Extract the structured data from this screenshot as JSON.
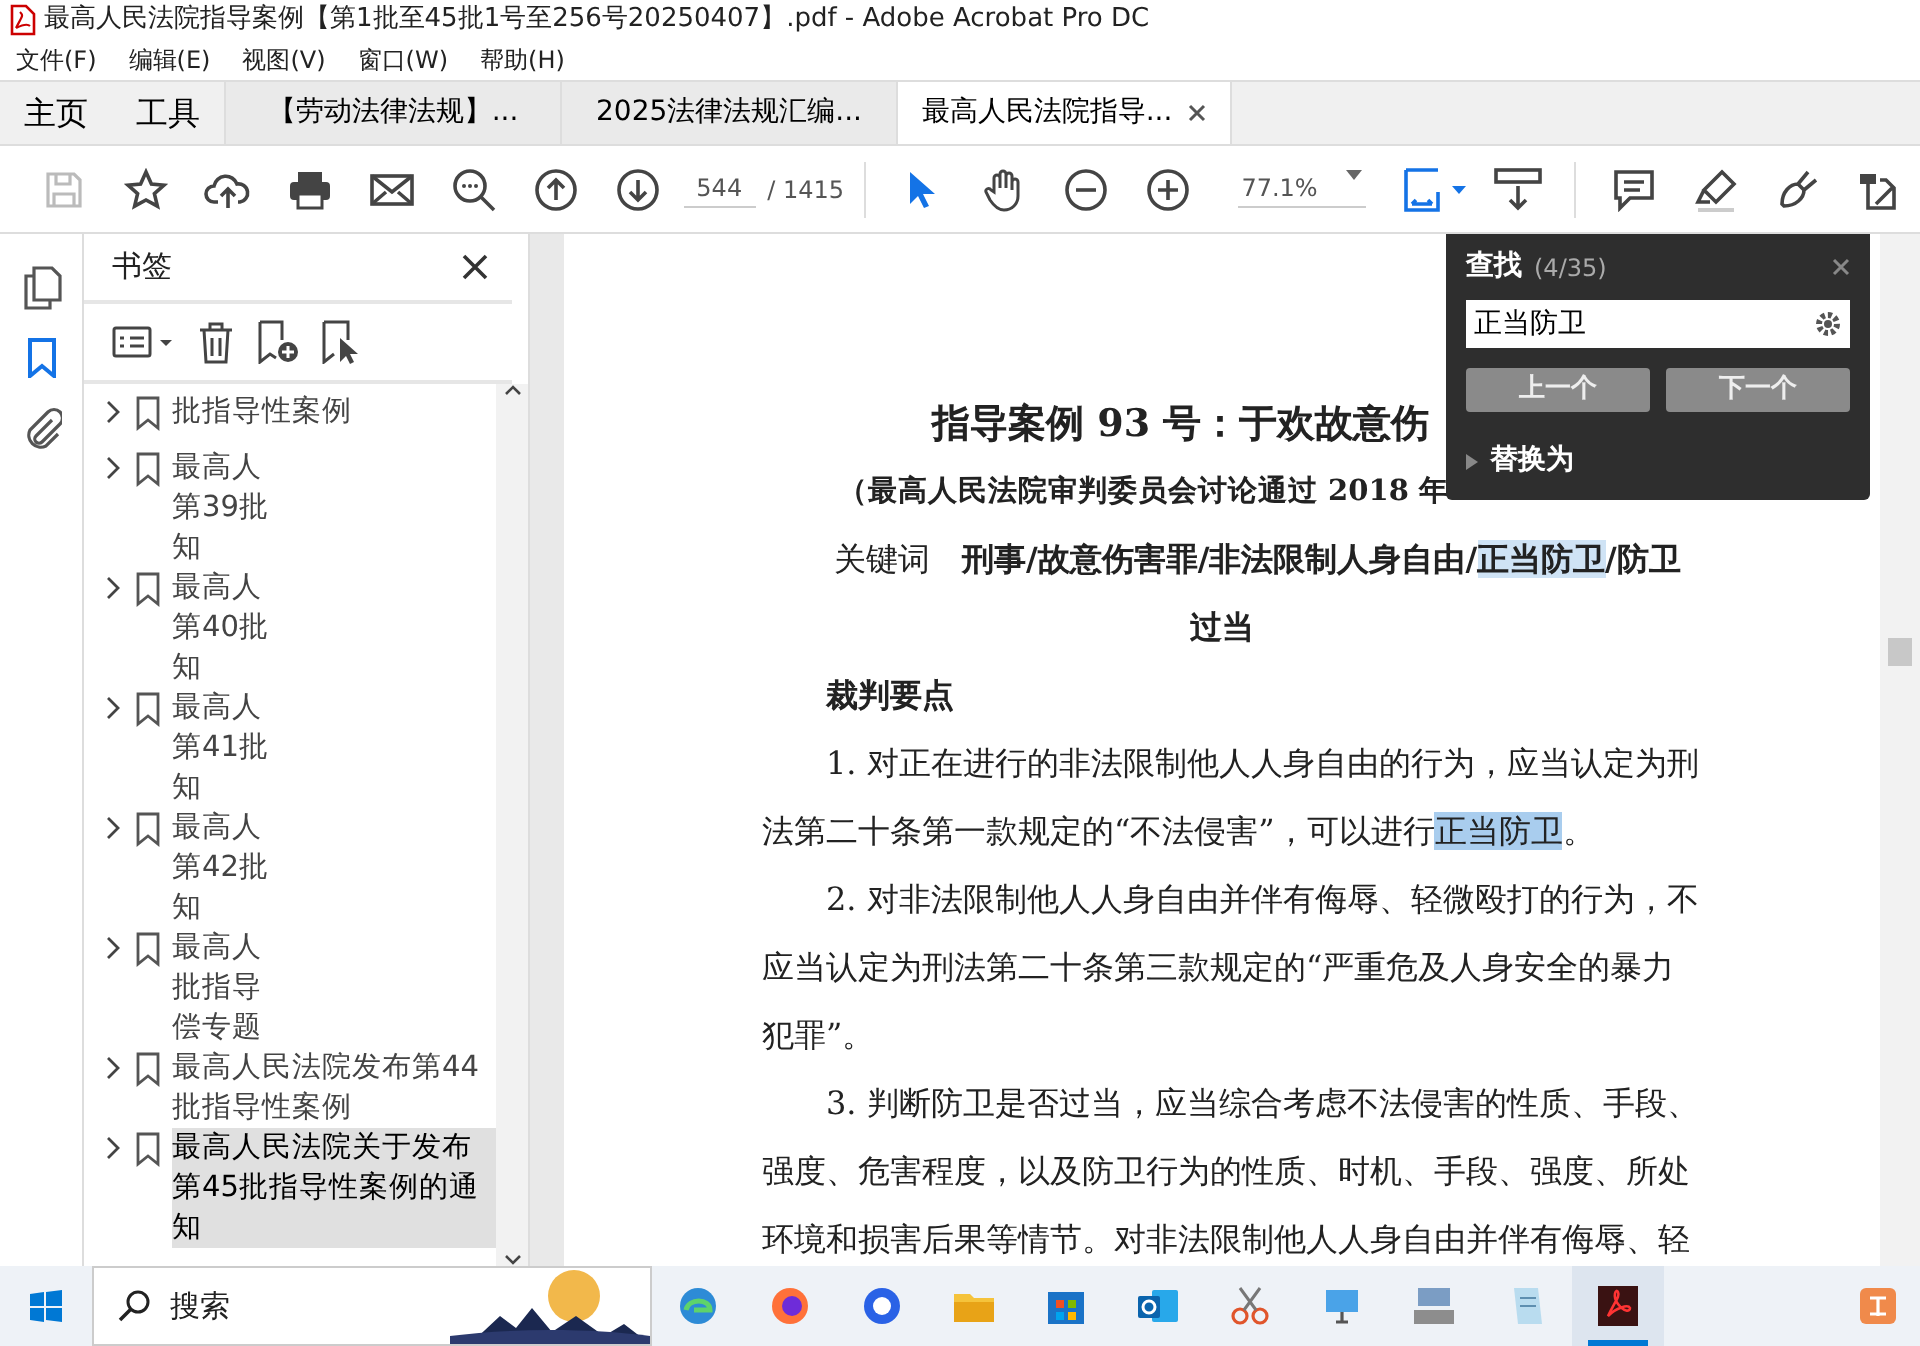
{
  "window": {
    "title": "最高人民法院指导案例【第1批至45批1号至256号20250407】.pdf - Adobe Acrobat Pro DC"
  },
  "menu": [
    "文件(F)",
    "编辑(E)",
    "视图(V)",
    "窗口(W)",
    "帮助(H)"
  ],
  "tabs": [
    {
      "label": "主页",
      "kind": "home",
      "selected": false
    },
    {
      "label": "工具",
      "kind": "home",
      "selected": false
    },
    {
      "label": "【劳动法律法规】...",
      "kind": "document",
      "selected": false
    },
    {
      "label": "2025法律法规汇编...",
      "kind": "document",
      "selected": false
    },
    {
      "label": "最高人民法院指导...",
      "kind": "document",
      "selected": true
    }
  ],
  "toolbar": {
    "page_current": "544",
    "page_total": "/ 1415",
    "zoom": "77.1%",
    "tools": [
      {
        "kind": "select",
        "selected": true
      },
      {
        "kind": "hand",
        "selected": false
      }
    ]
  },
  "side_rail": [
    {
      "kind": "pages",
      "selected": false
    },
    {
      "kind": "bookmarks",
      "selected": true
    },
    {
      "kind": "attachments",
      "selected": false
    }
  ],
  "bookmarks": {
    "title": "书签",
    "items": [
      {
        "lines": [
          "批指导性案例"
        ],
        "selected": false
      },
      {
        "lines": [
          "最高人",
          "第39批",
          "知"
        ],
        "selected": false
      },
      {
        "lines": [
          "最高人",
          "第40批",
          "知"
        ],
        "selected": false
      },
      {
        "lines": [
          "最高人",
          "第41批",
          "知"
        ],
        "selected": false
      },
      {
        "lines": [
          "最高人",
          "第42批",
          "知"
        ],
        "selected": false
      },
      {
        "lines": [
          "最高人",
          "批指导",
          "偿专题"
        ],
        "selected": false
      },
      {
        "lines": [
          "最高人民法院发布第44",
          "批指导性案例"
        ],
        "selected": false
      },
      {
        "lines": [
          "最高人民法院关于发布",
          "第45批指导性案例的通",
          "知"
        ],
        "selected": true
      }
    ]
  },
  "document": {
    "lines": [
      {
        "kind": "title",
        "segments": [
          {
            "text": "指导案例 93 号：于欢故意伤",
            "kind": "plain"
          }
        ]
      },
      {
        "kind": "subtitle",
        "segments": [
          {
            "text": "（最高人民法院审判委员会讨论通过 2018 年",
            "kind": "plain"
          }
        ]
      },
      {
        "kind": "keywords",
        "label": "关键词",
        "segments": [
          {
            "text": "刑事/故意伤害罪/非法限制人身自由/",
            "kind": "plain"
          },
          {
            "text": "正当防卫",
            "kind": "match"
          },
          {
            "text": "/防卫",
            "kind": "plain"
          }
        ]
      },
      {
        "kind": "center",
        "segments": [
          {
            "text": "过当",
            "kind": "plain"
          }
        ]
      },
      {
        "kind": "heading",
        "segments": [
          {
            "text": "裁判要点",
            "kind": "plain"
          }
        ]
      },
      {
        "kind": "first",
        "segments": [
          {
            "text": "1. 对正在进行的非法限制他人人身自由的行为，应当认定为刑",
            "kind": "plain"
          }
        ]
      },
      {
        "kind": "body",
        "segments": [
          {
            "text": "法第二十条第一款规定的“不法侵害”，可以进行",
            "kind": "plain"
          },
          {
            "text": "正当防卫",
            "kind": "current"
          },
          {
            "text": "。",
            "kind": "plain"
          }
        ]
      },
      {
        "kind": "first",
        "segments": [
          {
            "text": "2. 对非法限制他人人身自由并伴有侮辱、轻微殴打的行为，不",
            "kind": "plain"
          }
        ]
      },
      {
        "kind": "body",
        "segments": [
          {
            "text": "应当认定为刑法第二十条第三款规定的“严重危及人身安全的暴力",
            "kind": "plain"
          }
        ]
      },
      {
        "kind": "body",
        "segments": [
          {
            "text": "犯罪”。",
            "kind": "plain"
          }
        ]
      },
      {
        "kind": "first",
        "segments": [
          {
            "text": "3. 判断防卫是否过当，应当综合考虑不法侵害的性质、手段、",
            "kind": "plain"
          }
        ]
      },
      {
        "kind": "body",
        "segments": [
          {
            "text": "强度、危害程度，以及防卫行为的性质、时机、手段、强度、所处",
            "kind": "plain"
          }
        ]
      },
      {
        "kind": "body",
        "segments": [
          {
            "text": "环境和损害后果等情节。对非法限制他人人身自由并伴有侮辱、轻",
            "kind": "plain"
          }
        ]
      }
    ]
  },
  "find": {
    "title": "查找",
    "count": "(4/35)",
    "value": "正当防卫",
    "previous": "上一个",
    "next": "下一个",
    "replace": "替换为",
    "replace_expanded": false
  },
  "taskbar": {
    "search": "搜索",
    "apps": [
      {
        "kind": "edge",
        "active": false
      },
      {
        "kind": "firefox",
        "active": false
      },
      {
        "kind": "circle",
        "active": false
      },
      {
        "kind": "folder",
        "active": false
      },
      {
        "kind": "store",
        "active": false
      },
      {
        "kind": "mail",
        "active": false
      },
      {
        "kind": "scissors",
        "active": false
      },
      {
        "kind": "monitor",
        "active": false
      },
      {
        "kind": "computer",
        "active": false
      },
      {
        "kind": "notepad",
        "active": false
      },
      {
        "kind": "acrobat",
        "active": true
      }
    ]
  }
}
